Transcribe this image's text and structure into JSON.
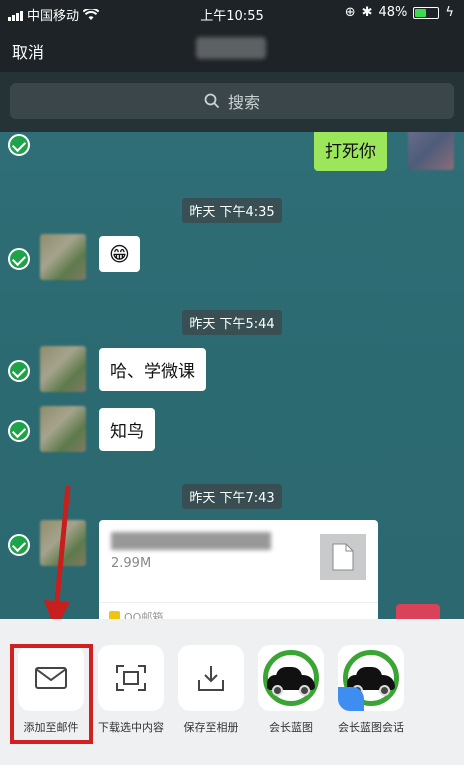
{
  "status_bar": {
    "carrier": "中国移动",
    "time": "上午10:55",
    "battery": "48%",
    "battery_level": 0.48
  },
  "nav": {
    "cancel": "取消"
  },
  "search": {
    "placeholder": "搜索"
  },
  "chat": {
    "sent_message": "打死你",
    "items": [
      {
        "time": "昨天 下午4:35"
      },
      {
        "time": "昨天 下午5:44",
        "messages": [
          "哈、学微课",
          "知鸟"
        ]
      },
      {
        "time": "昨天 下午7:43"
      }
    ],
    "file": {
      "size": "2.99M",
      "source": "QQ邮箱"
    },
    "emoji": "😁"
  },
  "actions": [
    {
      "label": "添加至邮件",
      "icon": "mail-icon"
    },
    {
      "label": "下载选中内容",
      "icon": "scan-frame-icon"
    },
    {
      "label": "保存至相册",
      "icon": "download-tray-icon"
    },
    {
      "label": "会长蓝图",
      "icon": "app-car-logo-icon"
    },
    {
      "label": "会长蓝图会话",
      "icon": "app-car-logo-chat-icon"
    }
  ]
}
